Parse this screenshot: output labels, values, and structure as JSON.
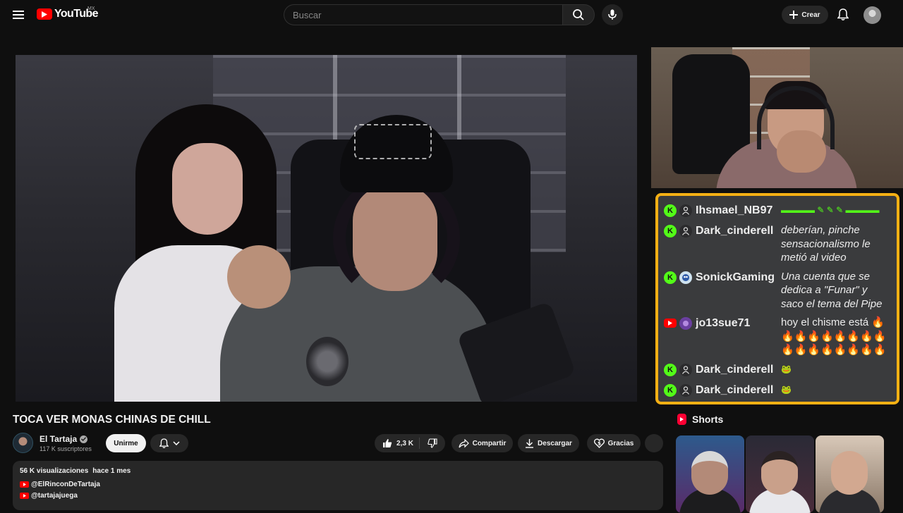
{
  "masthead": {
    "logo_text": "YouTube",
    "region": "MX",
    "search_placeholder": "Buscar",
    "create_label": "Crear"
  },
  "video": {
    "title": "TOCA VER MONAS CHINAS DE CHILL",
    "channel": "El Tartaja",
    "subscribers": "117 K suscriptores",
    "join_label": "Unirme",
    "likes": "2,3 K",
    "share_label": "Compartir",
    "download_label": "Descargar",
    "thanks_label": "Gracias",
    "views": "56 K visualizaciones",
    "age": "hace 1 mes",
    "links": [
      "@ElRinconDeTartaja",
      "@tartajajuega"
    ]
  },
  "chat": {
    "messages": [
      {
        "platform": "kick",
        "user": "Ihsmael_NB97",
        "text": "",
        "emote": "▬▬▬▬ ✎ ✎ ✎ ▬▬▬▬",
        "italic": false
      },
      {
        "platform": "kick",
        "user": "Dark_cinderell",
        "text": "deberían, pinche sensacionalismo le metió al video",
        "emote": "",
        "italic": true
      },
      {
        "platform": "kick",
        "user": "SonickGaming",
        "text": "Una cuenta que se dedica a \"Funar\" y saco el tema del Pipe",
        "emote": "",
        "italic": true
      },
      {
        "platform": "youtube",
        "user": "jo13sue71",
        "text": "hoy el chisme está 🔥🔥🔥🔥🔥🔥🔥🔥🔥🔥🔥🔥🔥🔥🔥🔥🔥",
        "emote": "",
        "italic": false
      },
      {
        "platform": "kick",
        "user": "Dark_cinderell",
        "text": "",
        "emote": "🐸",
        "italic": false
      },
      {
        "platform": "kick",
        "user": "Dark_cinderell",
        "text": "",
        "emote": "🐸",
        "italic": false
      }
    ]
  },
  "shorts": {
    "title": "Shorts"
  },
  "colors": {
    "accent_red": "#ff0000",
    "kick_green": "#53fc18",
    "chat_border": "#f5b014",
    "background": "#0f0f0f"
  }
}
